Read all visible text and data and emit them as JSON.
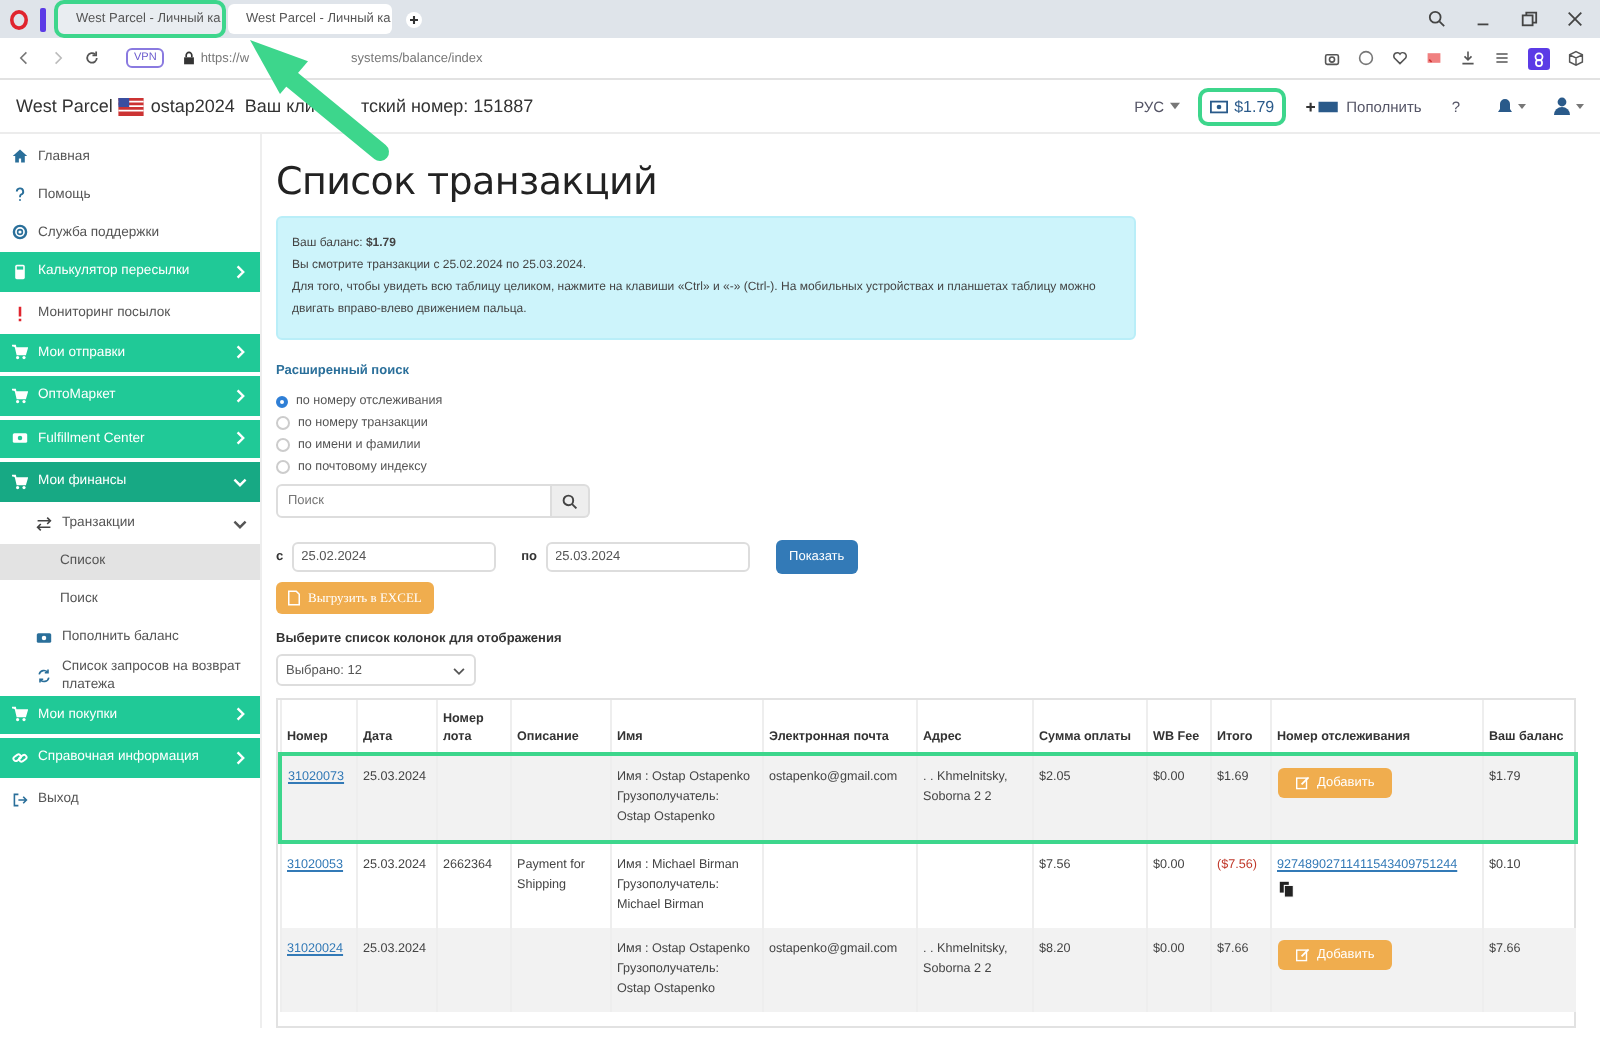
{
  "browser": {
    "tabs": [
      {
        "title": "West Parcel - Личный ка",
        "selected": false,
        "highlighted": true
      },
      {
        "title": "West Parcel - Личный ка",
        "selected": true,
        "highlighted": false
      }
    ],
    "vpn_badge": "VPN",
    "url_parts": [
      "https://w",
      "systems/balance/index"
    ]
  },
  "header": {
    "brand": "West Parcel",
    "username": "ostap2024",
    "client_number_parts": [
      "Ваш кли",
      "тский номер: 151887"
    ],
    "language": "РУС",
    "balance": "$1.79",
    "balance_highlighted": true,
    "top_up": "Пополнить",
    "help": "?"
  },
  "sidebar": {
    "items": [
      {
        "label": "Главная",
        "kind": "link",
        "selected": false
      },
      {
        "label": "Помощь",
        "kind": "link",
        "selected": false
      },
      {
        "label": "Служба поддержки",
        "kind": "link",
        "selected": false
      },
      {
        "label": "Калькулятор пересылки",
        "kind": "section",
        "expanded": false,
        "selected": false
      },
      {
        "label": "Мониторинг посылок",
        "kind": "link",
        "selected": false
      },
      {
        "label": "Мои отправки",
        "kind": "section",
        "expanded": false,
        "selected": false
      },
      {
        "label": "ОптоМаркет",
        "kind": "section",
        "expanded": false,
        "selected": false
      },
      {
        "label": "Fulfillment Center",
        "kind": "section",
        "expanded": false,
        "selected": false
      },
      {
        "label": "Мои финансы",
        "kind": "section",
        "expanded": true,
        "selected": false,
        "children": [
          {
            "label": "Транзакции",
            "expanded": true,
            "selected": false,
            "children": [
              {
                "label": "Список",
                "selected": true
              },
              {
                "label": "Поиск",
                "selected": false
              }
            ]
          },
          {
            "label": "Пополнить баланс",
            "selected": false
          },
          {
            "label": "Список запросов на возврат платежа",
            "selected": false
          }
        ]
      },
      {
        "label": "Мои покупки",
        "kind": "section",
        "expanded": false,
        "selected": false
      },
      {
        "label": "Справочная информация",
        "kind": "section",
        "expanded": false,
        "selected": false
      },
      {
        "label": "Выход",
        "kind": "link",
        "selected": false
      }
    ]
  },
  "page": {
    "title": "Список транзакций",
    "info": [
      "Ваш баланс: **$1.79**",
      "Вы смотрите транзакции с 25.02.2024 по 25.03.2024.",
      "Для того, чтобы увидеть всю таблицу целиком, нажмите на клавиши «Ctrl» и «-» (Ctrl-). На мобильных устройствах и планшетах таблицу можно двигать вправо-влево движением пальца."
    ],
    "advanced_search": {
      "title": "Расширенный поиск",
      "options": [
        {
          "label": "по номеру отслеживания",
          "selected": true
        },
        {
          "label": "по номеру транзакции",
          "selected": false
        },
        {
          "label": "по имени и фамилии",
          "selected": false
        },
        {
          "label": "по почтовому индексу",
          "selected": false
        }
      ],
      "placeholder": "Поиск"
    },
    "date_from_label": "с",
    "date_from": "25.02.2024",
    "date_to_label": "по",
    "date_to": "25.03.2024",
    "show_button": "Показать",
    "export_button": "Выгрузить в EXCEL",
    "columns_label": "Выберите список колонок для отображения",
    "columns_select": "Выбрано: 12"
  },
  "table": {
    "columns": [
      "Номер",
      "Дата",
      "Номер лота",
      "Описание",
      "Имя",
      "Электронная почта",
      "Адрес",
      "Сумма оплаты",
      "WB Fee",
      "Итого",
      "Номер отслеживания",
      "Ваш баланс"
    ],
    "rows": [
      {
        "number": "31020073",
        "date": "25.03.2024",
        "name": "Имя : Ostap Ostapenko",
        "recipient": "Грузополучатель: Ostap Ostapenko",
        "email": "ostapenko@gmail.com",
        "address": ". . Khmelnitsky, Soborna 2 2",
        "amount": "$2.05",
        "fee": "$0.00",
        "total": "$1.69",
        "negative": false,
        "tracking": {
          "kind": "button",
          "text": "Добавить"
        },
        "balance": "$1.79",
        "highlighted": true
      },
      {
        "number": "31020053",
        "date": "25.03.2024",
        "lot": "2662364",
        "description": "Payment for Shipping",
        "name": "Имя : Michael Birman",
        "recipient": "Грузополучатель: Michael Birman",
        "amount": "$7.56",
        "fee": "$0.00",
        "total": "($7.56)",
        "negative": true,
        "tracking": {
          "kind": "link",
          "text": "92748902711411543409751244"
        },
        "balance": "$0.10",
        "highlighted": false
      },
      {
        "number": "31020024",
        "date": "25.03.2024",
        "name": "Имя : Ostap Ostapenko",
        "recipient": "Грузополучатель: Ostap Ostapenko",
        "email": "ostapenko@gmail.com",
        "address": ". . Khmelnitsky, Soborna 2 2",
        "amount": "$8.20",
        "fee": "$0.00",
        "total": "$7.66",
        "negative": false,
        "tracking": {
          "kind": "button",
          "text": "Добавить"
        },
        "balance": "$7.66",
        "highlighted": false
      }
    ]
  }
}
